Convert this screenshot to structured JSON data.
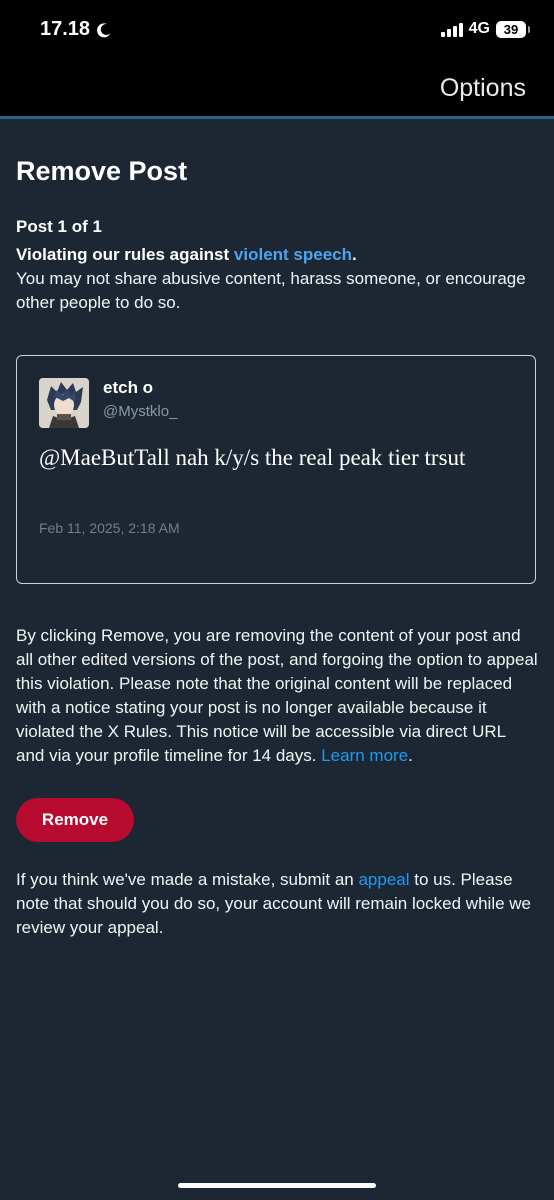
{
  "status_bar": {
    "time": "17.18",
    "network": "4G",
    "battery": "39"
  },
  "nav": {
    "options_label": "Options"
  },
  "page": {
    "title": "Remove Post",
    "post_count": "Post 1 of 1",
    "rule_prefix": "Violating our rules against ",
    "rule_link": "violent speech",
    "rule_suffix": ".",
    "rule_description": "You may not share abusive content, harass someone, or encourage other people to do so."
  },
  "post": {
    "author_name": "etch o",
    "author_handle": "@Mystklo_",
    "text": "@MaeButTall nah k/y/s the real peak tier trsut",
    "date": "Feb 11, 2025, 2:18 AM"
  },
  "notice": {
    "text": "By clicking Remove, you are removing the content of your post and all other edited versions of the post, and forgoing the option to appeal this violation. Please note that the original content will be replaced with a notice stating your post is no longer available because it violated the X Rules. This notice will be accessible via direct URL and via your profile timeline for 14 days. ",
    "learn_more_label": "Learn more",
    "end": "."
  },
  "actions": {
    "remove_label": "Remove"
  },
  "appeal": {
    "prefix": "If you think we've made a mistake, submit an ",
    "link_label": "appeal",
    "suffix": " to us. Please note that should you do so, your account will remain locked while we review your appeal."
  },
  "colors": {
    "background": "#1c2733",
    "link": "#1d9bf0",
    "remove_button": "#b60a2f"
  },
  "icons": {
    "moon": "moon-icon",
    "signal": "cellular-signal-icon",
    "battery": "battery-icon"
  }
}
